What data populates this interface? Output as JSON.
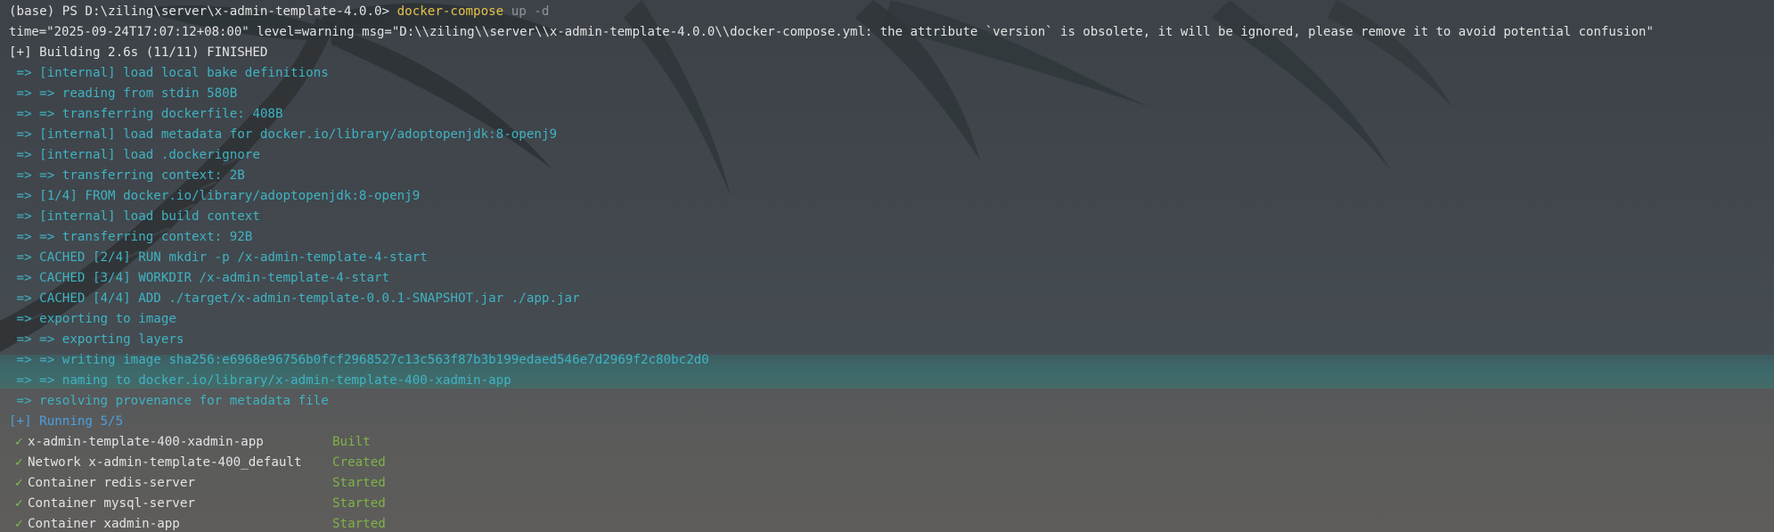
{
  "prompt": {
    "prefix": "(base) PS D:\\ziling\\server\\x-admin-template-4.0.0> ",
    "command": "docker-compose",
    "args": " up -d"
  },
  "warning_line": "time=\"2025-09-24T17:07:12+08:00\" level=warning msg=\"D:\\\\ziling\\\\server\\\\x-admin-template-4.0.0\\\\docker-compose.yml: the attribute `version` is obsolete, it will be ignored, please remove it to avoid potential confusion\"",
  "building_line": "[+] Building 2.6s (11/11) FINISHED",
  "build_steps": [
    " => [internal] load local bake definitions",
    " => => reading from stdin 580B",
    " => => transferring dockerfile: 408B",
    " => [internal] load metadata for docker.io/library/adoptopenjdk:8-openj9",
    " => [internal] load .dockerignore",
    " => => transferring context: 2B",
    " => [1/4] FROM docker.io/library/adoptopenjdk:8-openj9",
    " => [internal] load build context",
    " => => transferring context: 92B",
    " => CACHED [2/4] RUN mkdir -p /x-admin-template-4-start",
    " => CACHED [3/4] WORKDIR /x-admin-template-4-start",
    " => CACHED [4/4] ADD ./target/x-admin-template-0.0.1-SNAPSHOT.jar ./app.jar",
    " => exporting to image",
    " => => exporting layers",
    " => => writing image sha256:e6968e96756b0fcf2968527c13c563f87b3b199edaed546e7d2969f2c80bc2d0",
    " => => naming to docker.io/library/x-admin-template-400-xadmin-app",
    " => resolving provenance for metadata file"
  ],
  "running_line": "[+] Running 5/5",
  "services": [
    {
      "name": "x-admin-template-400-xadmin-app",
      "status": "Built"
    },
    {
      "name": "Network x-admin-template-400_default",
      "status": "Created"
    },
    {
      "name": "Container redis-server",
      "status": "Started"
    },
    {
      "name": "Container mysql-server",
      "status": "Started"
    },
    {
      "name": "Container xadmin-app",
      "status": "Started"
    }
  ],
  "check_glyph": "✓",
  "colors": {
    "step_text": "#3fb3c2",
    "running_text": "#4aa0e0",
    "command": "#e5c24a",
    "args": "#8d9499",
    "status": "#7fb347",
    "check": "#7fc24a"
  }
}
